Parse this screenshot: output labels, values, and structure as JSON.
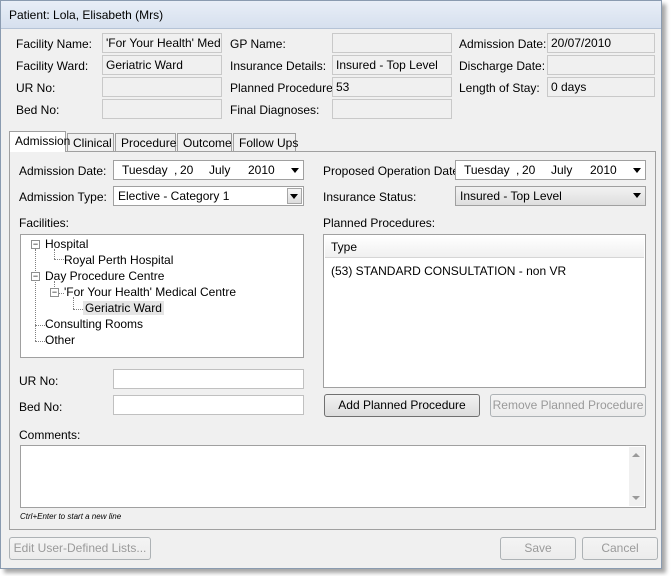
{
  "window": {
    "title": "Patient: Lola, Elisabeth (Mrs)"
  },
  "header": {
    "facility_name_label": "Facility Name:",
    "facility_name_value": "'For Your Health' Medical Centre",
    "facility_ward_label": "Facility Ward:",
    "facility_ward_value": "Geriatric Ward",
    "ur_no_label": "UR No:",
    "ur_no_value": "",
    "bed_no_label": "Bed No:",
    "bed_no_value": "",
    "gp_name_label": "GP Name:",
    "gp_name_value": "",
    "insurance_details_label": "Insurance Details:",
    "insurance_details_value": "Insured - Top Level",
    "planned_procedures_label": "Planned Procedures:",
    "planned_procedures_value": "53",
    "final_diagnoses_label": "Final Diagnoses:",
    "final_diagnoses_value": "",
    "admission_date_label": "Admission Date:",
    "admission_date_value": "20/07/2010",
    "discharge_date_label": "Discharge Date:",
    "discharge_date_value": "",
    "length_of_stay_label": "Length of Stay:",
    "length_of_stay_value": "0 days"
  },
  "tabs": [
    {
      "label": "Admission",
      "active": true
    },
    {
      "label": "Clinical",
      "active": false
    },
    {
      "label": "Procedures",
      "active": false
    },
    {
      "label": "Outcome",
      "active": false
    },
    {
      "label": "Follow Ups",
      "active": false
    }
  ],
  "admission": {
    "admission_date_label": "Admission Date:",
    "admission_date": {
      "weekday": "Tuesday",
      "sep": ",",
      "day": "20",
      "month": "July",
      "year": "2010"
    },
    "admission_type_label": "Admission Type:",
    "admission_type_value": "Elective - Category 1",
    "proposed_op_label": "Proposed Operation Date:",
    "proposed_op_date": {
      "weekday": "Tuesday",
      "sep": ",",
      "day": "20",
      "month": "July",
      "year": "2010"
    },
    "insurance_status_label": "Insurance Status:",
    "insurance_status_value": "Insured - Top Level",
    "facilities_label": "Facilities:",
    "facilities_tree": {
      "hospital": "Hospital",
      "royal_perth": "Royal Perth Hospital",
      "day_procedure": "Day Procedure Centre",
      "for_your_health": "'For Your Health' Medical Centre",
      "geriatric_ward": "Geriatric Ward",
      "consulting_rooms": "Consulting Rooms",
      "other": "Other"
    },
    "planned_procedures_label": "Planned Procedures:",
    "procedures_column": "Type",
    "procedures": [
      "(53) STANDARD CONSULTATION - non VR"
    ],
    "ur_no_label": "UR No:",
    "ur_no_value": "",
    "bed_no_label": "Bed No:",
    "bed_no_value": "",
    "add_procedure_label": "Add Planned Procedure",
    "remove_procedure_label": "Remove Planned Procedure",
    "comments_label": "Comments:",
    "comments_value": "",
    "comments_hint": "Ctrl+Enter to start a new line"
  },
  "footer": {
    "edit_lists_label": "Edit User-Defined Lists...",
    "save_label": "Save",
    "cancel_label": "Cancel"
  },
  "colors": {
    "selected_node_bg": "#e5e5e5",
    "titlebar": "#dbe4f0",
    "disabled_text": "#9a9a9a"
  }
}
